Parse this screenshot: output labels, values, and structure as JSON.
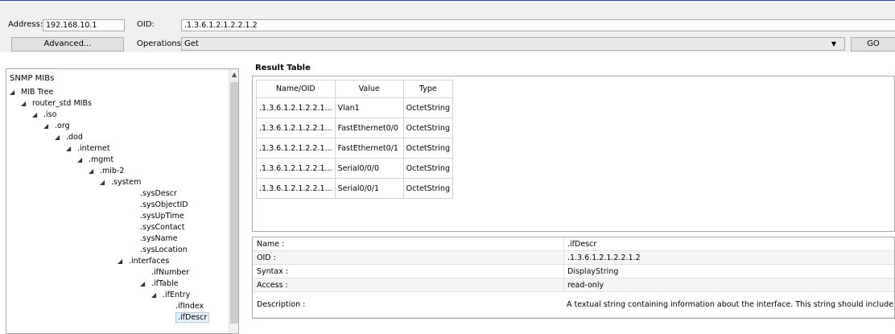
{
  "toolbar": {
    "address_label": "Address:",
    "address_value": "192.168.10.1",
    "oid_label": "OID:",
    "oid_value": ".1.3.6.1.2.1.2.2.1.2",
    "advanced_label": "Advanced...",
    "operations_label": "Operations:",
    "operation_value": "Get",
    "go_label": "GO"
  },
  "tree": {
    "header": "SNMP MIBs",
    "items": [
      {
        "label": "MIB Tree",
        "expanded": true
      },
      {
        "label": "router_std MIBs",
        "expanded": true
      },
      {
        "label": ".iso",
        "expanded": true
      },
      {
        "label": ".org",
        "expanded": true
      },
      {
        "label": ".dod",
        "expanded": true
      },
      {
        "label": ".internet",
        "expanded": true
      },
      {
        "label": ".mgmt",
        "expanded": true
      },
      {
        "label": ".mib-2",
        "expanded": true
      },
      {
        "label": ".system",
        "expanded": true
      },
      {
        "label": ".sysDescr"
      },
      {
        "label": ".sysObjectID"
      },
      {
        "label": ".sysUpTime"
      },
      {
        "label": ".sysContact"
      },
      {
        "label": ".sysName"
      },
      {
        "label": ".sysLocation"
      },
      {
        "label": ".interfaces",
        "expanded": true
      },
      {
        "label": ".ifNumber"
      },
      {
        "label": ".ifTable",
        "expanded": true
      },
      {
        "label": ".ifEntry",
        "expanded": true
      },
      {
        "label": ".ifIndex"
      },
      {
        "label": ".ifDescr",
        "selected": true
      }
    ]
  },
  "result": {
    "title": "Result Table",
    "columns": [
      "Name/OID",
      "Value",
      "Type"
    ],
    "rows": [
      [
        ".1.3.6.1.2.1.2.2.1...",
        "Vlan1",
        "OctetString"
      ],
      [
        ".1.3.6.1.2.1.2.2.1...",
        "FastEthernet0/0",
        "OctetString"
      ],
      [
        ".1.3.6.1.2.1.2.2.1...",
        "FastEthernet0/1",
        "OctetString"
      ],
      [
        ".1.3.6.1.2.1.2.2.1...",
        "Serial0/0/0",
        "OctetString"
      ],
      [
        ".1.3.6.1.2.1.2.2.1...",
        "Serial0/0/1",
        "OctetString"
      ]
    ]
  },
  "details": [
    {
      "key": "Name :",
      "value": ".ifDescr"
    },
    {
      "key": "OID :",
      "value": ".1.3.6.1.2.1.2.2.1.2"
    },
    {
      "key": "Syntax :",
      "value": "DisplayString"
    },
    {
      "key": "Access :",
      "value": "read-only"
    },
    {
      "key": "Description :",
      "value": "A textual string containing information about the interface. This string should include the r"
    }
  ]
}
